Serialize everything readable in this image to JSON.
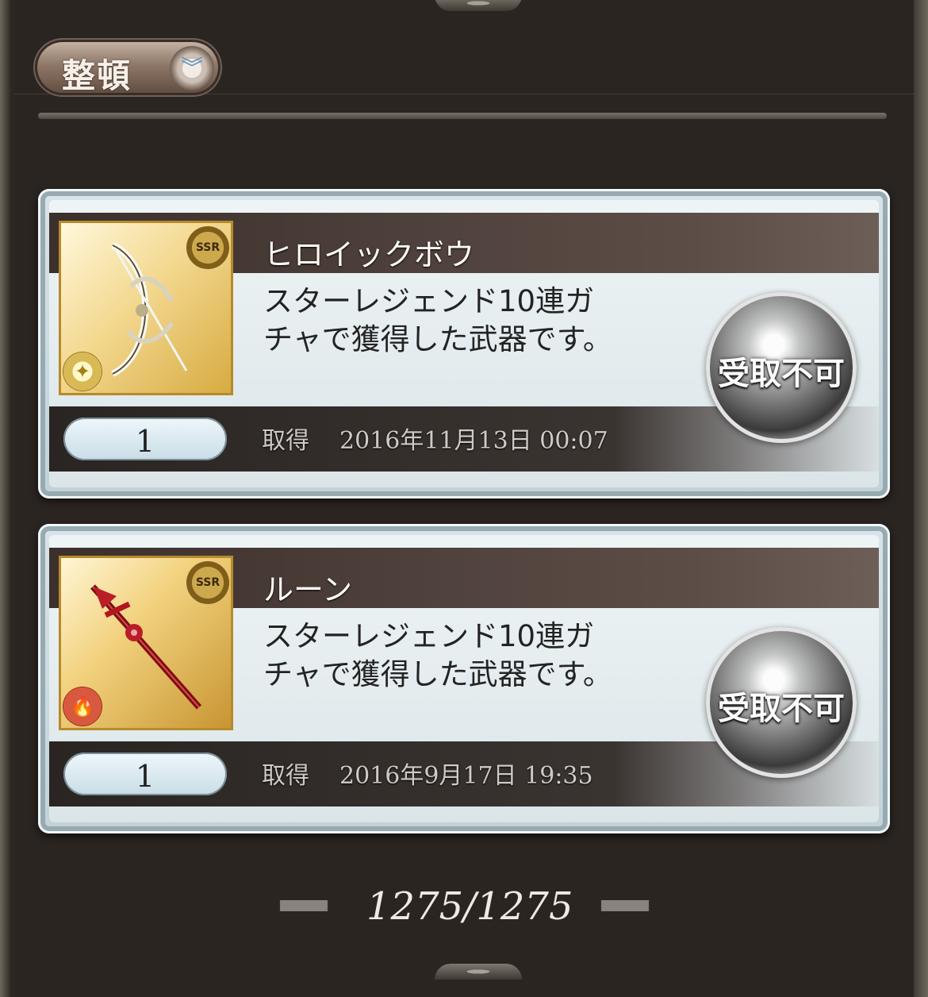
{
  "toolbar": {
    "sort_label": "整頓",
    "sort_icon": "double-chevron-down-icon"
  },
  "items": [
    {
      "name": "ヒロイックボウ",
      "description_line1": "スターレジェンド10連ガ",
      "description_line2": "チャで獲得した武器です。",
      "count": "1",
      "acquired_label": "取得",
      "acquired_date": "2016年11月13日 00:07",
      "button_label": "受取不可",
      "rarity": "SSR",
      "element_icon": "light-element-icon",
      "weapon_icon": "bow-icon"
    },
    {
      "name": "ルーン",
      "description_line1": "スターレジェンド10連ガ",
      "description_line2": "チャで獲得した武器です。",
      "count": "1",
      "acquired_label": "取得",
      "acquired_date": "2016年9月17日 19:35",
      "button_label": "受取不可",
      "rarity": "SSR",
      "element_icon": "fire-element-icon",
      "weapon_icon": "spear-icon"
    }
  ],
  "pager": {
    "count_text": "1275/1275"
  },
  "colors": {
    "background": "#2b2521",
    "card_face": "#dbe5e8",
    "title_band": "#3b302c",
    "button_text": "#fdfcfb"
  }
}
